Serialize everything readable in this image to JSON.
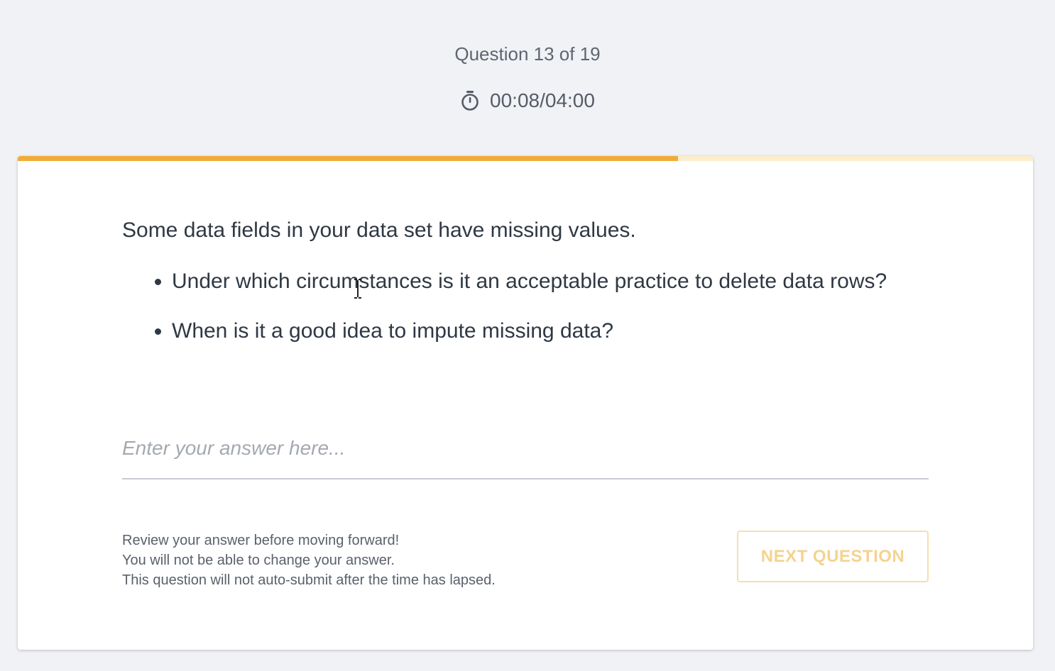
{
  "header": {
    "question_counter": "Question 13 of 19",
    "timer_icon": "stopwatch-icon",
    "timer": "00:08/04:00"
  },
  "progress": {
    "fraction": 0.65,
    "fill_color": "#f0ac38",
    "track_color": "#fdeecb"
  },
  "question": {
    "intro": "Some data fields in your data set have missing values.",
    "bullets": [
      "Under which circumstances is it an acceptable practice to delete data rows?",
      "When is it a good idea to impute missing data?"
    ]
  },
  "answer": {
    "value": "",
    "placeholder": "Enter your answer here..."
  },
  "notes": [
    "Review your answer before moving forward!",
    "You will not be able to change your answer.",
    "This question will not auto-submit after the time has lapsed."
  ],
  "actions": {
    "next_label": "NEXT QUESTION",
    "next_color": "#f5d38f"
  }
}
